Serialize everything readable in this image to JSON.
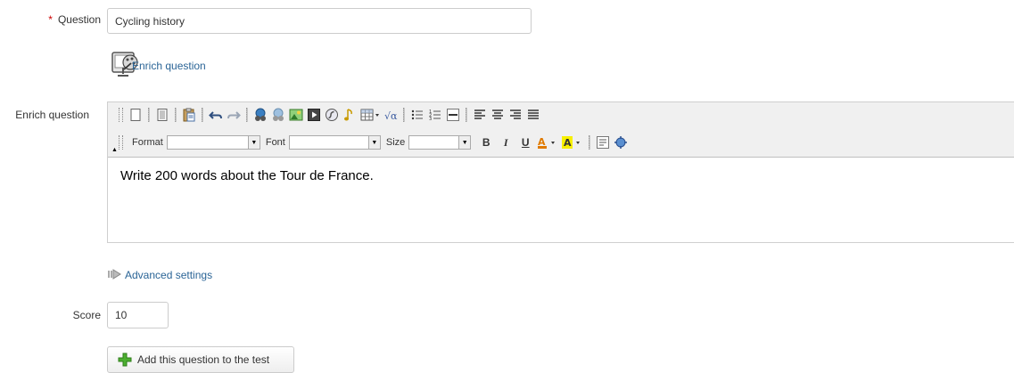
{
  "question": {
    "required_mark": "*",
    "label": "Question",
    "value": "Cycling history"
  },
  "enrich_link": {
    "label": "Enrich question"
  },
  "editor": {
    "label": "Enrich question",
    "toolbar": {
      "format_label": "Format",
      "font_label": "Font",
      "size_label": "Size",
      "bold": "B",
      "italic": "I",
      "underline": "U"
    },
    "content": "Write 200 words about the Tour de France."
  },
  "advanced": {
    "label": "Advanced settings"
  },
  "score": {
    "label": "Score",
    "value": "10"
  },
  "submit": {
    "label": "Add this question to the test"
  },
  "colors": {
    "link": "#2a6496",
    "required": "#cc0000",
    "add_icon": "#4caf30"
  }
}
